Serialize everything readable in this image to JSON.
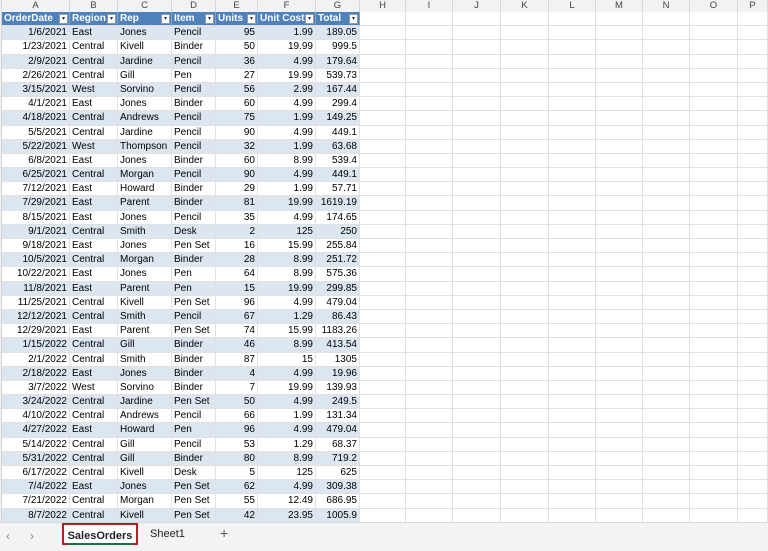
{
  "columns": [
    "A",
    "B",
    "C",
    "D",
    "E",
    "F",
    "G",
    "H",
    "I",
    "J",
    "K",
    "L",
    "M",
    "N",
    "O",
    "P"
  ],
  "headers": [
    "OrderDate",
    "Region",
    "Rep",
    "Item",
    "Units",
    "Unit Cost",
    "Total"
  ],
  "rows": [
    [
      "1/6/2021",
      "East",
      "Jones",
      "Pencil",
      "95",
      "1.99",
      "189.05"
    ],
    [
      "1/23/2021",
      "Central",
      "Kivell",
      "Binder",
      "50",
      "19.99",
      "999.5"
    ],
    [
      "2/9/2021",
      "Central",
      "Jardine",
      "Pencil",
      "36",
      "4.99",
      "179.64"
    ],
    [
      "2/26/2021",
      "Central",
      "Gill",
      "Pen",
      "27",
      "19.99",
      "539.73"
    ],
    [
      "3/15/2021",
      "West",
      "Sorvino",
      "Pencil",
      "56",
      "2.99",
      "167.44"
    ],
    [
      "4/1/2021",
      "East",
      "Jones",
      "Binder",
      "60",
      "4.99",
      "299.4"
    ],
    [
      "4/18/2021",
      "Central",
      "Andrews",
      "Pencil",
      "75",
      "1.99",
      "149.25"
    ],
    [
      "5/5/2021",
      "Central",
      "Jardine",
      "Pencil",
      "90",
      "4.99",
      "449.1"
    ],
    [
      "5/22/2021",
      "West",
      "Thompson",
      "Pencil",
      "32",
      "1.99",
      "63.68"
    ],
    [
      "6/8/2021",
      "East",
      "Jones",
      "Binder",
      "60",
      "8.99",
      "539.4"
    ],
    [
      "6/25/2021",
      "Central",
      "Morgan",
      "Pencil",
      "90",
      "4.99",
      "449.1"
    ],
    [
      "7/12/2021",
      "East",
      "Howard",
      "Binder",
      "29",
      "1.99",
      "57.71"
    ],
    [
      "7/29/2021",
      "East",
      "Parent",
      "Binder",
      "81",
      "19.99",
      "1619.19"
    ],
    [
      "8/15/2021",
      "East",
      "Jones",
      "Pencil",
      "35",
      "4.99",
      "174.65"
    ],
    [
      "9/1/2021",
      "Central",
      "Smith",
      "Desk",
      "2",
      "125",
      "250"
    ],
    [
      "9/18/2021",
      "East",
      "Jones",
      "Pen Set",
      "16",
      "15.99",
      "255.84"
    ],
    [
      "10/5/2021",
      "Central",
      "Morgan",
      "Binder",
      "28",
      "8.99",
      "251.72"
    ],
    [
      "10/22/2021",
      "East",
      "Jones",
      "Pen",
      "64",
      "8.99",
      "575.36"
    ],
    [
      "11/8/2021",
      "East",
      "Parent",
      "Pen",
      "15",
      "19.99",
      "299.85"
    ],
    [
      "11/25/2021",
      "Central",
      "Kivell",
      "Pen Set",
      "96",
      "4.99",
      "479.04"
    ],
    [
      "12/12/2021",
      "Central",
      "Smith",
      "Pencil",
      "67",
      "1.29",
      "86.43"
    ],
    [
      "12/29/2021",
      "East",
      "Parent",
      "Pen Set",
      "74",
      "15.99",
      "1183.26"
    ],
    [
      "1/15/2022",
      "Central",
      "Gill",
      "Binder",
      "46",
      "8.99",
      "413.54"
    ],
    [
      "2/1/2022",
      "Central",
      "Smith",
      "Binder",
      "87",
      "15",
      "1305"
    ],
    [
      "2/18/2022",
      "East",
      "Jones",
      "Binder",
      "4",
      "4.99",
      "19.96"
    ],
    [
      "3/7/2022",
      "West",
      "Sorvino",
      "Binder",
      "7",
      "19.99",
      "139.93"
    ],
    [
      "3/24/2022",
      "Central",
      "Jardine",
      "Pen Set",
      "50",
      "4.99",
      "249.5"
    ],
    [
      "4/10/2022",
      "Central",
      "Andrews",
      "Pencil",
      "66",
      "1.99",
      "131.34"
    ],
    [
      "4/27/2022",
      "East",
      "Howard",
      "Pen",
      "96",
      "4.99",
      "479.04"
    ],
    [
      "5/14/2022",
      "Central",
      "Gill",
      "Pencil",
      "53",
      "1.29",
      "68.37"
    ],
    [
      "5/31/2022",
      "Central",
      "Gill",
      "Binder",
      "80",
      "8.99",
      "719.2"
    ],
    [
      "6/17/2022",
      "Central",
      "Kivell",
      "Desk",
      "5",
      "125",
      "625"
    ],
    [
      "7/4/2022",
      "East",
      "Jones",
      "Pen Set",
      "62",
      "4.99",
      "309.38"
    ],
    [
      "7/21/2022",
      "Central",
      "Morgan",
      "Pen Set",
      "55",
      "12.49",
      "686.95"
    ],
    [
      "8/7/2022",
      "Central",
      "Kivell",
      "Pen Set",
      "42",
      "23.95",
      "1005.9"
    ]
  ],
  "tabs": {
    "nav_prev": "‹",
    "nav_next": "›",
    "active": "SalesOrders",
    "second": "Sheet1",
    "add": "+"
  },
  "colors": {
    "header_blue": "#4f81bd",
    "band_blue": "#dce6f1",
    "active_tab_outline": "#b11f24"
  }
}
